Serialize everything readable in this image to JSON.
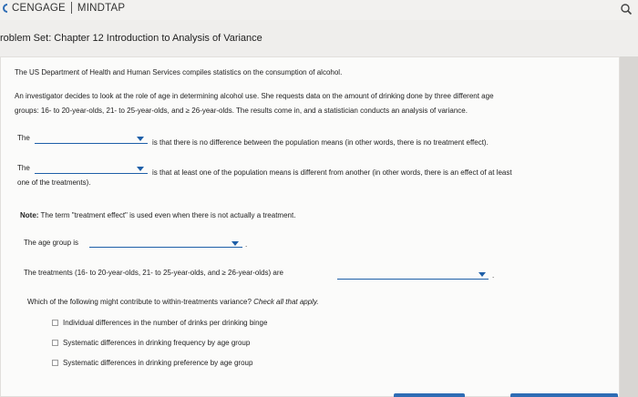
{
  "app": {
    "brand": "CENGAGE",
    "product": "MINDTAP",
    "search_icon": "search-icon"
  },
  "problem_title": "roblem Set: Chapter 12 Introduction to Analysis of Variance",
  "intro": "The US Department of Health and Human Services compiles statistics on the consumption of alcohol.",
  "scenario_line1": "An investigator decides to look at the role of age in determining alcohol use. She requests data on the amount of drinking done by three different age",
  "scenario_line2": "groups: 16- to 20-year-olds, 21- to 25-year-olds, and ≥ 26-year-olds. The results come in, and a statistician conducts an analysis of variance.",
  "q1": {
    "prefix": "The",
    "selected": "",
    "suffix": "is that there is no difference between the population means (in other words, there is no treatment effect)."
  },
  "q2": {
    "prefix": "The",
    "selected": "",
    "suffix": "is that at least one of the population means is different from another (in other words, there is an effect of at least",
    "continuation": "one of the treatments)."
  },
  "note": {
    "label": "Note:",
    "text": "The term \"treatment effect\" is used even when there is not actually a treatment."
  },
  "q3": {
    "prefix": "The age group is",
    "selected": "",
    "suffix": "."
  },
  "q4": {
    "prefix": "The treatments (16- to 20-year-olds, 21- to 25-year-olds, and ≥ 26-year-olds) are",
    "selected": "",
    "suffix": "."
  },
  "q5": {
    "question": "Which of the following might contribute to within-treatments variance?",
    "instruction": "Check all that apply.",
    "options": [
      {
        "label": "Individual differences in the number of drinks per drinking binge",
        "checked": false
      },
      {
        "label": "Systematic differences in drinking frequency by age group",
        "checked": false
      },
      {
        "label": "Systematic differences in drinking preference by age group",
        "checked": false
      }
    ]
  },
  "colors": {
    "accent": "#1e5fa8",
    "button": "#2f6db5",
    "background": "#d8d6d3",
    "panel": "#fbfbfa"
  }
}
